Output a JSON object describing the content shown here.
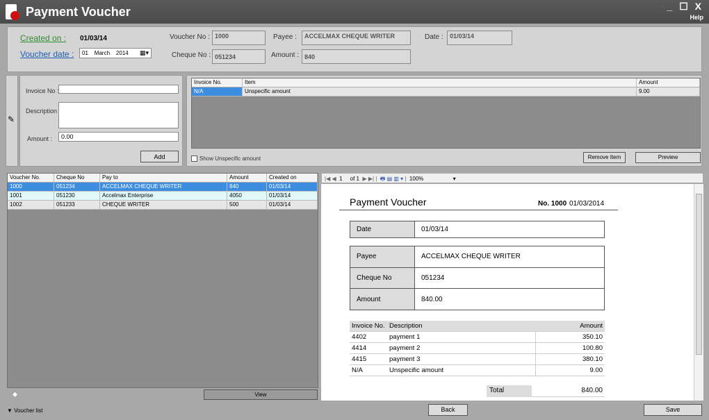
{
  "app": {
    "title": "Payment Voucher",
    "help": "Help",
    "win_controls": "_ ☐ X"
  },
  "header": {
    "created_on_label": "Created on :",
    "created_on_value": "01/03/14",
    "voucher_date_label": "Voucher date :",
    "voucher_date": {
      "day": "01",
      "month": "March",
      "year": "2014"
    },
    "voucher_no_label": "Voucher No :",
    "voucher_no": "1000",
    "cheque_no_label": "Cheque No :",
    "cheque_no": "051234",
    "payee_label": "Payee :",
    "payee": "ACCELMAX CHEQUE WRITER",
    "amount_label": "Amount :",
    "amount": "840",
    "date_label": "Date :",
    "date": "01/03/14"
  },
  "item_form": {
    "invoice_label": "Invoice No :",
    "description_label": "Description :",
    "amount_label": "Amount :",
    "amount_value": "0.00",
    "add_label": "Add"
  },
  "items_grid": {
    "columns": [
      "Invoice No.",
      "Item",
      "Amount"
    ],
    "rows": [
      {
        "invoice": "N/A",
        "item": "Unspecific amount",
        "amount": "9.00"
      }
    ],
    "show_unspecific_label": "Show Unspecific amount",
    "remove_label": "Remove Item",
    "preview_label": "Preview"
  },
  "voucher_list": {
    "columns": [
      "Voucher No.",
      "Cheque No",
      "Pay to",
      "Amount",
      "Created on"
    ],
    "rows": [
      {
        "no": "1000",
        "cheque": "051234",
        "payto": "ACCELMAX CHEQUE WRITER",
        "amount": "840",
        "created": "01/03/14"
      },
      {
        "no": "1001",
        "cheque": "051230",
        "payto": "Accelmax Enterprise",
        "amount": "4050",
        "created": "01/03/14"
      },
      {
        "no": "1002",
        "cheque": "051233",
        "payto": "CHEQUE WRITER",
        "amount": "500",
        "created": "01/03/14"
      }
    ],
    "view_label": "View",
    "toggle_label": "Voucher list"
  },
  "report_toolbar": {
    "page": "1",
    "of": "of 1",
    "zoom": "100%"
  },
  "report": {
    "title": "Payment Voucher",
    "no_label": "No. 1000",
    "no_date": "01/03/2014",
    "date_label": "Date",
    "date": "01/03/14",
    "payee_label": "Payee",
    "payee": "ACCELMAX CHEQUE WRITER",
    "cheque_label": "Cheque No",
    "cheque": "051234",
    "amount_label": "Amount",
    "amount": "840.00",
    "items_header": {
      "inv": "Invoice No.",
      "desc": "Description",
      "amt": "Amount"
    },
    "items": [
      {
        "inv": "4402",
        "desc": "payment 1",
        "amt": "350.10"
      },
      {
        "inv": "4414",
        "desc": "payment 2",
        "amt": "100.80"
      },
      {
        "inv": "4415",
        "desc": "payment 3",
        "amt": "380.10"
      },
      {
        "inv": "N/A",
        "desc": "Unspecific amount",
        "amt": "9.00"
      }
    ],
    "total_label": "Total",
    "total": "840.00"
  },
  "footer": {
    "back_label": "Back",
    "save_label": "Save"
  }
}
